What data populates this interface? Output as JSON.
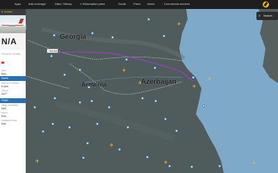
{
  "nav": {
    "items": [
      "Apps",
      "Add coverage",
      "Data / History",
      "Subscription plans",
      "Social",
      "Press",
      "About",
      "Commercial services"
    ]
  },
  "search": {
    "label": "Search"
  },
  "panel": {
    "route": "N/A",
    "country_label": "COUNTRY OF REG.",
    "msn_label": "MSN",
    "msn_value": "N/A",
    "speed_section": "Speed",
    "vertical_speed_label": "VERTICAL SPEED",
    "vertical_speed_value": "0 fpm",
    "track_label": "TRACK",
    "track_value": "267°",
    "graph_section": "Graph",
    "true_airspeed_label": "TRUE AIRSPEED",
    "true_airspeed_value": "N/A",
    "mach_label": "MACH",
    "mach_value": "N/A",
    "temperature_label": "TEMPERATURE",
    "temperature_value": "N/A"
  },
  "map": {
    "labels": {
      "georgia": "Georgia",
      "armenia": "Armenia",
      "azerbaijan": "Azerbaijan"
    },
    "origin_tag": "TBS/AB"
  },
  "colors": {
    "flight_path": "#9b3fc8",
    "aircraft": "#f2c12e",
    "land": "#4f5a5a",
    "sea": "#7fa9c9"
  }
}
